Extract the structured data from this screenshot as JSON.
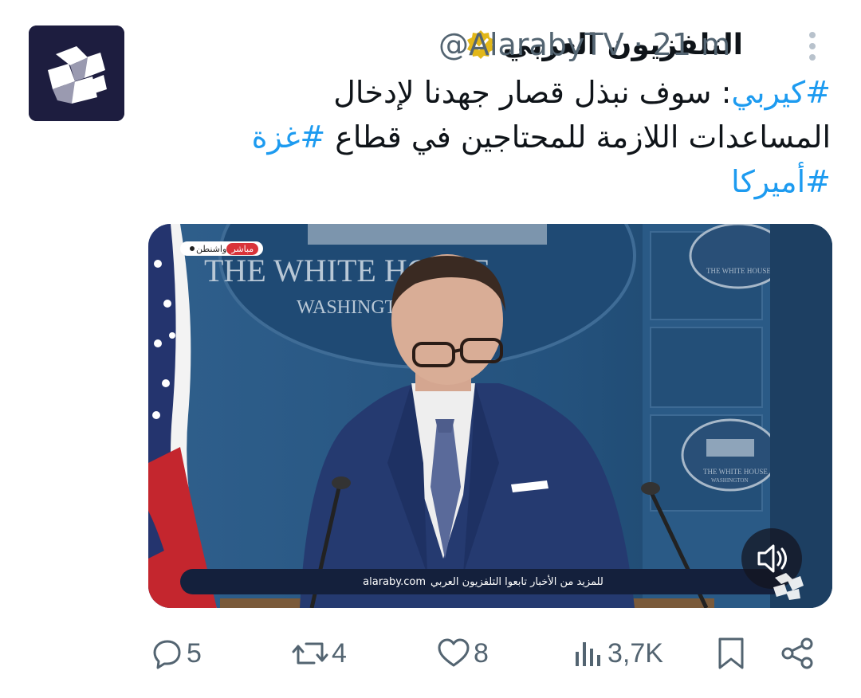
{
  "tweet": {
    "display_name": "التلفزيون العربي",
    "handle": "@AlarabyTV",
    "separator": "·",
    "time": "21 m",
    "line1_tag": "#كيربي",
    "line1_text": ": سوف نبذل قصار جهدنا لإدخال",
    "line2_text": "المساعدات اللازمة للمحتاجين في قطاع ",
    "line2_tag": "#غزة",
    "line3_tag": "#أميركا"
  },
  "media": {
    "live_label": "مباشر",
    "location": "واشنطن",
    "banner_text": "للمزيد من الأخبار تابعوا التلفزيون العربي",
    "banner_site": "alaraby.com",
    "backdrop_text_1": "THE WHITE HOUSE",
    "backdrop_text_2": "WASHINGTON",
    "sign_text_1": "THE WHITE HOUSE",
    "sign_text_2": "WASHINGTON"
  },
  "actions": {
    "replies": "5",
    "reposts": "4",
    "likes": "8",
    "views": "3,7K"
  },
  "colors": {
    "accent": "#1d9bf0",
    "text": "#0f1419",
    "muted": "#536471",
    "verified_gold": "#e2b719"
  }
}
